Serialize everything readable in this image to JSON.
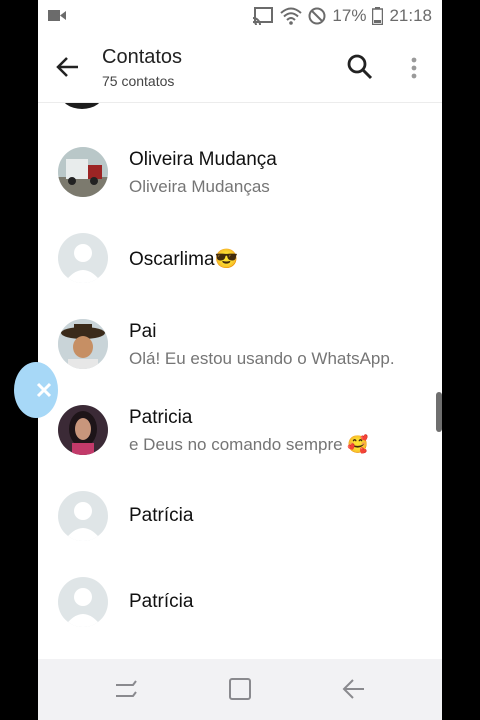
{
  "statusbar": {
    "battery": "17%",
    "time": "21:18"
  },
  "header": {
    "title": "Contatos",
    "subtitle": "75 contatos"
  },
  "contacts": [
    {
      "name": "Oliveira Mudança",
      "status": "Oliveira Mudanças"
    },
    {
      "name": "Oscarlima😎",
      "status": ""
    },
    {
      "name": "Pai",
      "status": "Olá! Eu estou usando o WhatsApp."
    },
    {
      "name": "Patricia",
      "status": "e Deus no comando sempre 🥰"
    },
    {
      "name": "Patrícia",
      "status": ""
    },
    {
      "name": "Patrícia",
      "status": ""
    }
  ],
  "colors": {
    "icon_gray": "#6b6b6b",
    "default_avatar": "#dfe5e7",
    "bubble": "#a7d8f7"
  },
  "icons": [
    "video-icon",
    "cast-icon",
    "wifi-icon",
    "no-disturb-icon",
    "battery-icon",
    "back-arrow-icon",
    "search-icon",
    "more-vert-icon",
    "recent-apps-icon",
    "home-icon",
    "back-nav-icon"
  ]
}
